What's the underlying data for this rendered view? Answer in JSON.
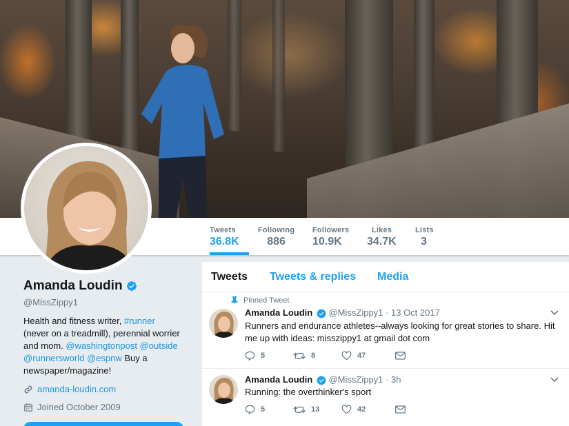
{
  "profile": {
    "name": "Amanda Loudin",
    "handle": "@MissZippy1",
    "bio": {
      "part1": "Health and fitness writer, ",
      "tag_runner": "#runner",
      "part2": " (never on a treadmill), perennial worrier and mom. ",
      "mention_wapo": "@washingtonpost",
      "mention_outside": "@outside",
      "mention_rw": "@runnersworld",
      "mention_espnw": "@espnw",
      "part3": " Buy a newspaper/magazine!"
    },
    "website": "amanda-loudin.com",
    "joined": "Joined October 2009"
  },
  "stats": [
    {
      "label": "Tweets",
      "value": "36.8K"
    },
    {
      "label": "Following",
      "value": "886"
    },
    {
      "label": "Followers",
      "value": "10.9K"
    },
    {
      "label": "Likes",
      "value": "34.7K"
    },
    {
      "label": "Lists",
      "value": "3"
    }
  ],
  "tabs": [
    "Tweets",
    "Tweets & replies",
    "Media"
  ],
  "tweets": [
    {
      "pinned_label": "Pinned Tweet",
      "name": "Amanda Loudin",
      "handle": "@MissZippy1",
      "sep": "·",
      "time": "13 Oct 2017",
      "text": "Runners and endurance athletes--always looking for great stories to share. Hit me up with ideas: misszippy1 at gmail dot com",
      "replies": "5",
      "retweets": "8",
      "likes": "47"
    },
    {
      "name": "Amanda Loudin",
      "handle": "@MissZippy1",
      "sep": "·",
      "time": "3h",
      "text": "Running: the overthinker's sport",
      "replies": "5",
      "retweets": "13",
      "likes": "42"
    }
  ],
  "colors": {
    "accent": "#1da1f2",
    "link": "#1b95e0",
    "muted": "#657786",
    "background": "#e6ecf0"
  }
}
